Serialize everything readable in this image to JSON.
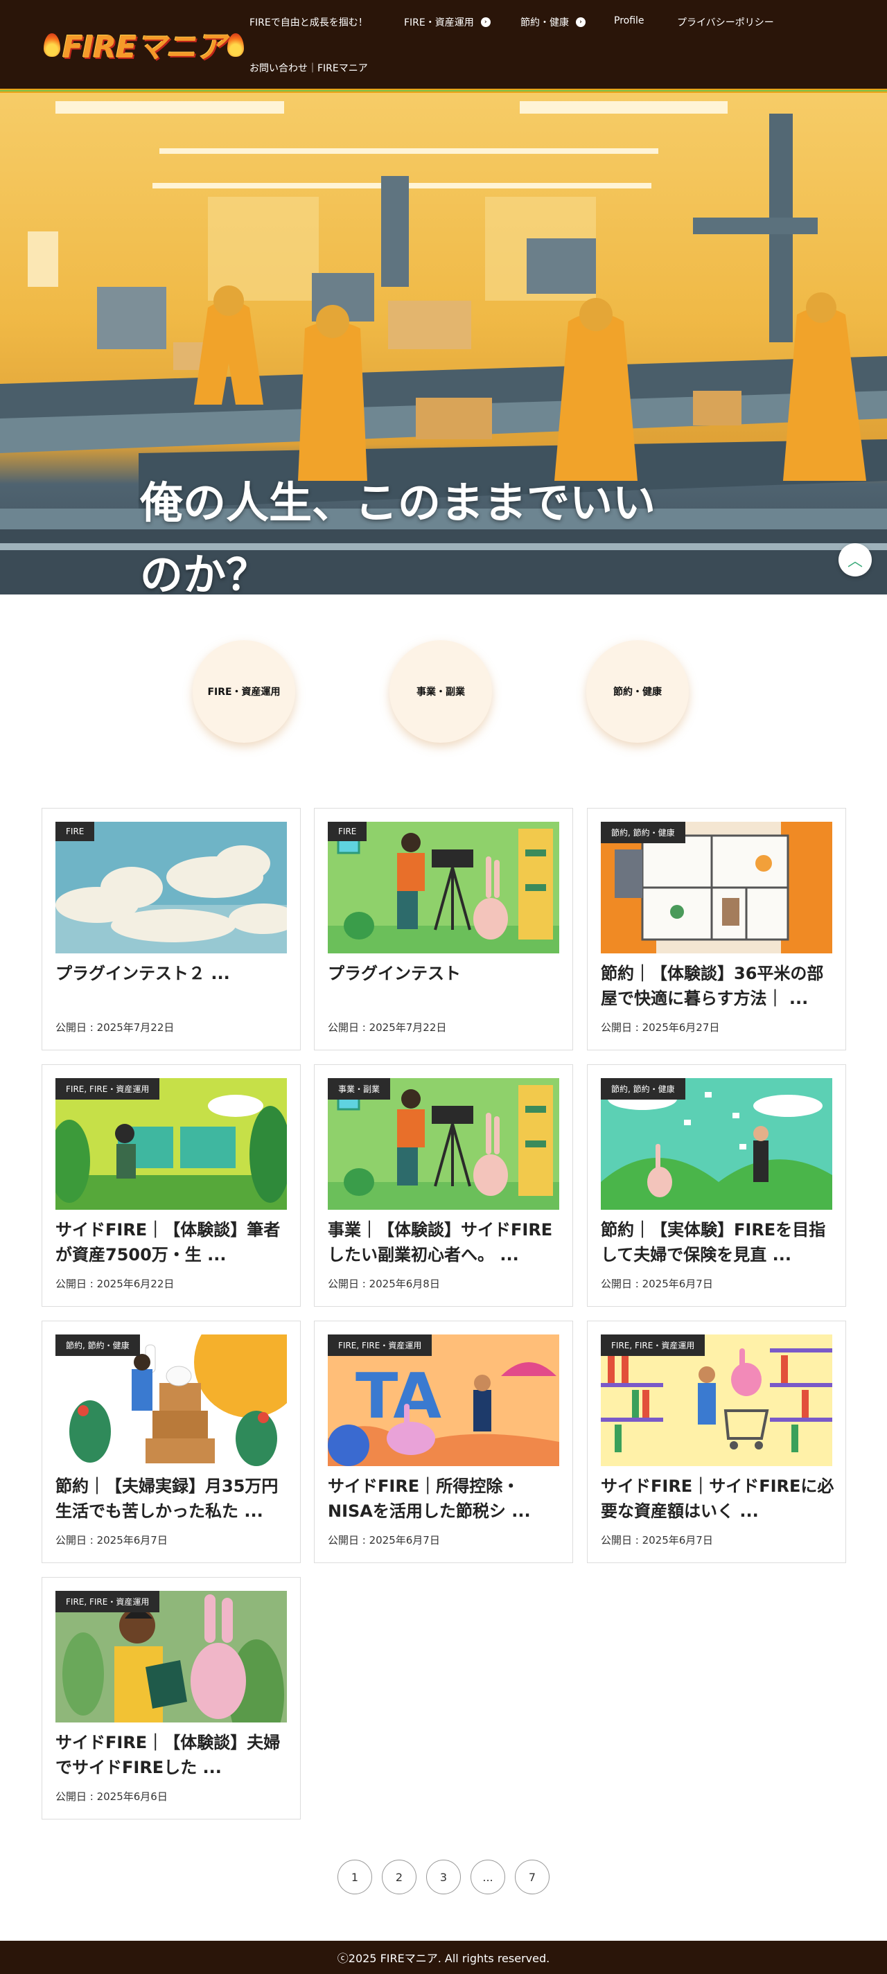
{
  "header": {
    "logo_text": "FIREマニア",
    "nav": [
      {
        "label": "FIREで自由と成長を掴む！"
      },
      {
        "label": "FIRE・資産運用",
        "arrow": "chevron-right"
      },
      {
        "label": "節約・健康",
        "arrow": "chevron-right"
      },
      {
        "label": "Profile"
      },
      {
        "label": "プライバシーポリシー"
      },
      {
        "label": "お問い合わせ｜FIREマニア"
      }
    ]
  },
  "hero": {
    "title": "俺の人生、このままでいいのか？",
    "scroll_top_icon": "chevron-up-icon"
  },
  "categories": [
    {
      "label": "FIRE・資産運用"
    },
    {
      "label": "事業・副業"
    },
    {
      "label": "節約・健康"
    }
  ],
  "posts": [
    {
      "tag": "FIRE",
      "title": "プラグインテスト２ ...",
      "date": "公開日 : 2025年7月22日",
      "thumb": "sky-clouds"
    },
    {
      "tag": "FIRE",
      "title": "プラグインテスト",
      "date": "公開日 : 2025年7月22日",
      "thumb": "camera-rabbit"
    },
    {
      "tag": "節約, 節約・健康",
      "title": "節約｜【体験談】36平米の部屋で快適に暮らす方法｜ ...",
      "date": "公開日 : 2025年6月27日",
      "thumb": "floor-plan"
    },
    {
      "tag": "FIRE, FIRE・資産運用",
      "title": "サイドFIRE｜【体験談】筆者が資産7500万・生 ...",
      "date": "公開日 : 2025年6月22日",
      "thumb": "green-office"
    },
    {
      "tag": "事業・副業",
      "title": "事業｜【体験談】サイドFIREしたい副業初心者へ。 ...",
      "date": "公開日 : 2025年6月8日",
      "thumb": "camera-rabbit"
    },
    {
      "tag": "節約, 節約・健康",
      "title": "節約｜【実体験】FIREを目指して夫婦で保険を見直 ...",
      "date": "公開日 : 2025年6月7日",
      "thumb": "paper-rain"
    },
    {
      "tag": "節約, 節約・健康",
      "title": "節約｜【夫婦実録】月35万円生活でも苦しかった私た ...",
      "date": "公開日 : 2025年6月7日",
      "thumb": "boxes-rabbit"
    },
    {
      "tag": "FIRE, FIRE・資産運用",
      "title": "サイドFIRE｜所得控除・NISAを活用した節税シ ...",
      "date": "公開日 : 2025年6月7日",
      "thumb": "tax-letters"
    },
    {
      "tag": "FIRE, FIRE・資産運用",
      "title": "サイドFIRE｜サイドFIREに必要な資産額はいく ...",
      "date": "公開日 : 2025年6月7日",
      "thumb": "shopping"
    },
    {
      "tag": "FIRE, FIRE・資産運用",
      "title": "サイドFIRE｜【体験談】夫婦でサイドFIREした ...",
      "date": "公開日 : 2025年6月6日",
      "thumb": "reading"
    }
  ],
  "pagination": [
    "1",
    "2",
    "3",
    "...",
    "7"
  ],
  "footer": {
    "copyright": "ⓒ2025 FIREマニア. All rights reserved."
  }
}
